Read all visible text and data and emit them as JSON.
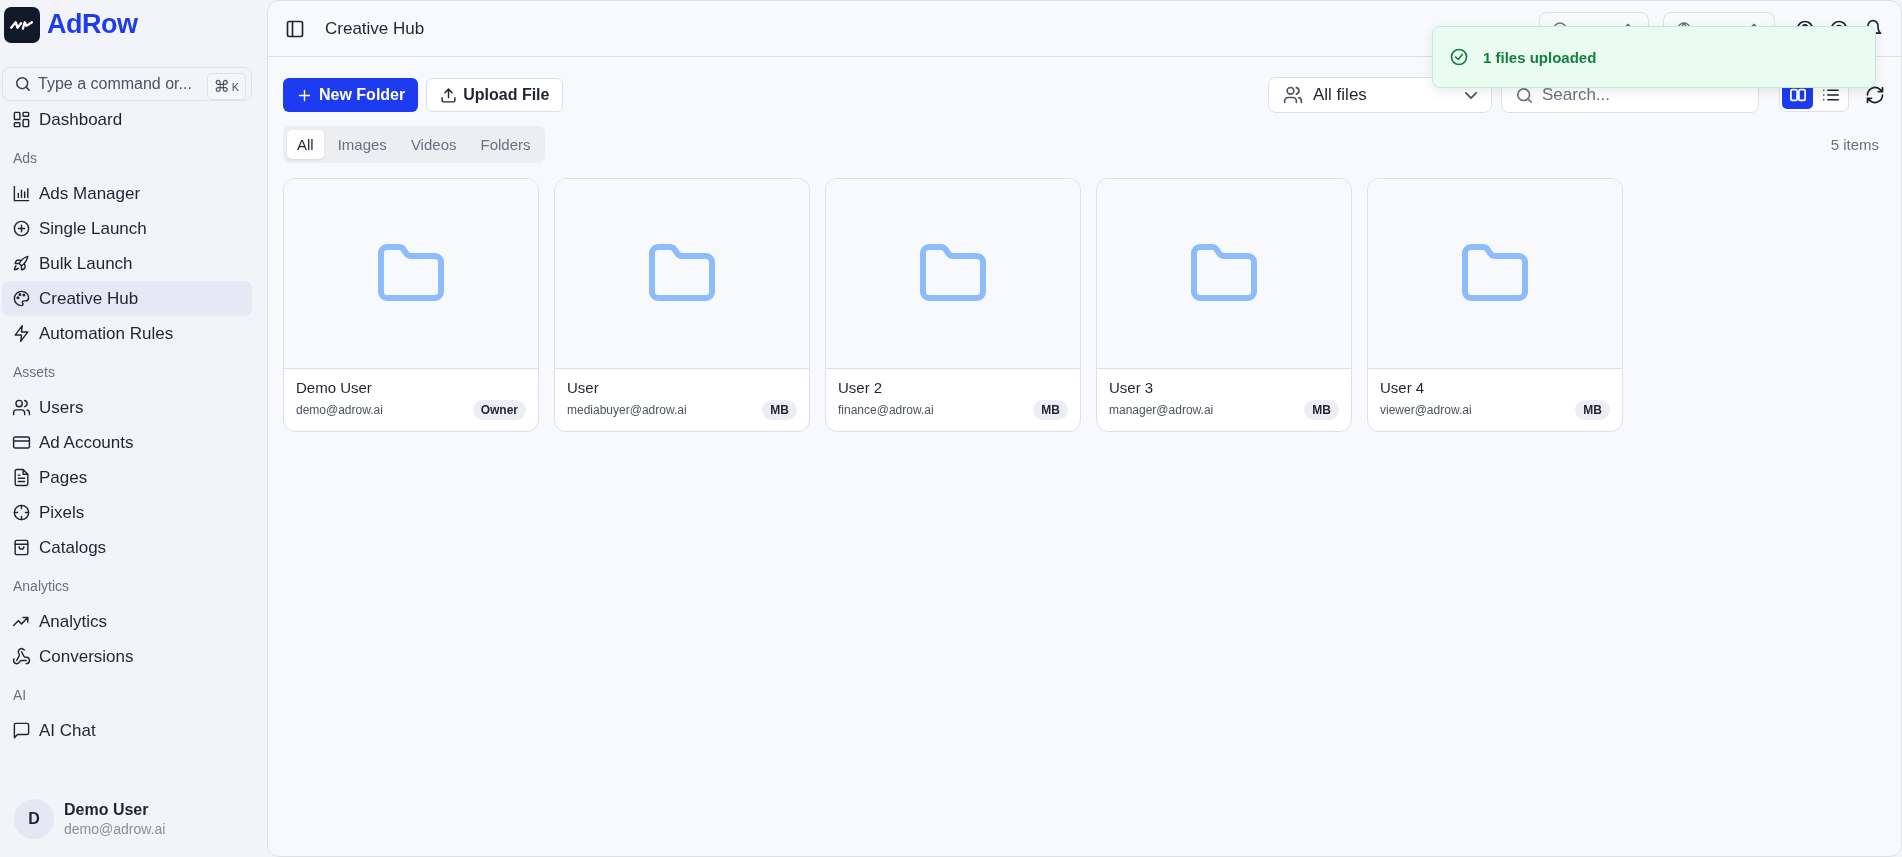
{
  "brand": {
    "name": "AdRow"
  },
  "command_search": {
    "placeholder": "Type a command or...",
    "shortcut_symbol": "⌘",
    "shortcut_key": "K"
  },
  "sidebar": {
    "groups": [
      {
        "items": [
          {
            "label": "Dashboard",
            "selected": false
          }
        ]
      },
      {
        "label": "Ads",
        "items": [
          {
            "label": "Ads Manager",
            "selected": false
          },
          {
            "label": "Single Launch",
            "selected": false
          },
          {
            "label": "Bulk Launch",
            "selected": false
          },
          {
            "label": "Creative Hub",
            "selected": true
          },
          {
            "label": "Automation Rules",
            "selected": false
          }
        ]
      },
      {
        "label": "Assets",
        "items": [
          {
            "label": "Users",
            "selected": false
          },
          {
            "label": "Ad Accounts",
            "selected": false
          },
          {
            "label": "Pages",
            "selected": false
          },
          {
            "label": "Pixels",
            "selected": false
          },
          {
            "label": "Catalogs",
            "selected": false
          }
        ]
      },
      {
        "label": "Analytics",
        "items": [
          {
            "label": "Analytics",
            "selected": false
          },
          {
            "label": "Conversions",
            "selected": false
          }
        ]
      },
      {
        "label": "AI",
        "items": [
          {
            "label": "AI Chat",
            "selected": false
          }
        ]
      }
    ]
  },
  "user": {
    "initial": "D",
    "name": "Demo User",
    "email": "demo@adrow.ai"
  },
  "header": {
    "title": "Creative Hub"
  },
  "toast": {
    "message": "1 files uploaded"
  },
  "toolbar": {
    "new_folder": "New Folder",
    "upload": "Upload File",
    "owner_filter": "All files",
    "search_placeholder": "Search...",
    "view_modes": [
      {
        "selected": true
      },
      {
        "selected": false
      }
    ]
  },
  "tabs": [
    {
      "label": "All",
      "selected": true
    },
    {
      "label": "Images",
      "selected": false
    },
    {
      "label": "Videos",
      "selected": false
    },
    {
      "label": "Folders",
      "selected": false
    }
  ],
  "item_count": "5 items",
  "folders": [
    {
      "name": "Demo User",
      "email": "demo@adrow.ai",
      "role": "Owner"
    },
    {
      "name": "User",
      "email": "mediabuyer@adrow.ai",
      "role": "MB"
    },
    {
      "name": "User 2",
      "email": "finance@adrow.ai",
      "role": "MB"
    },
    {
      "name": "User 3",
      "email": "manager@adrow.ai",
      "role": "MB"
    },
    {
      "name": "User 4",
      "email": "viewer@adrow.ai",
      "role": "MB"
    }
  ]
}
